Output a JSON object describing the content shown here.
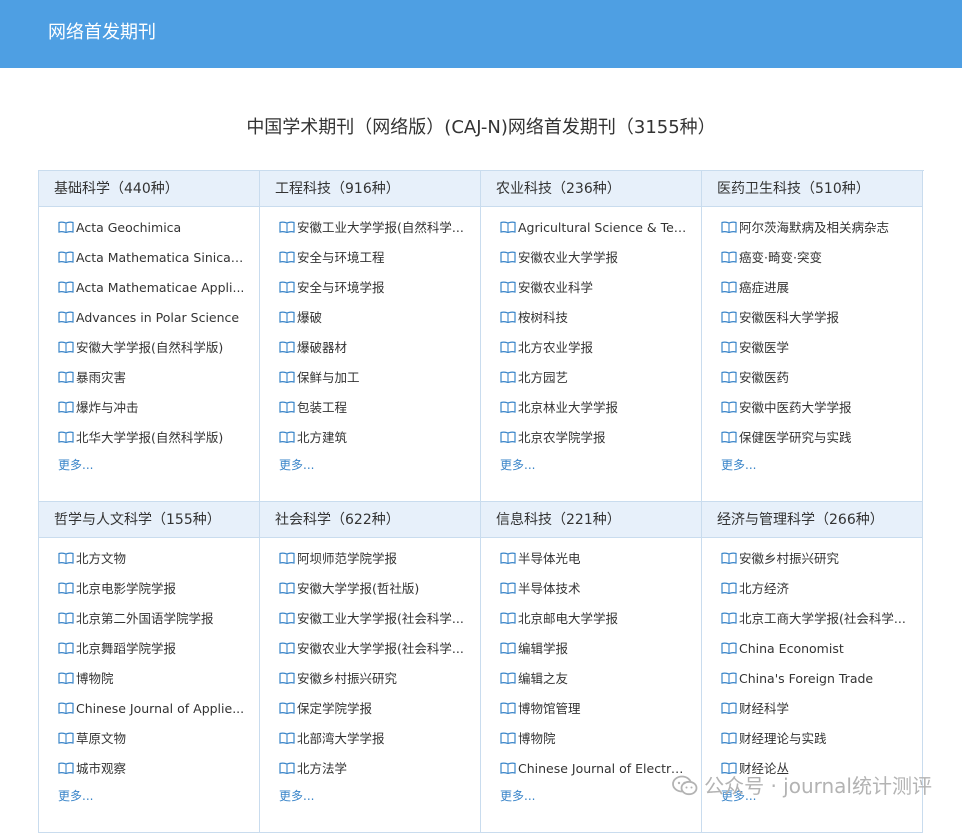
{
  "header": {
    "title": "网络首发期刊"
  },
  "page_title": "中国学术期刊（网络版）(CAJ-N)网络首发期刊（3155种）",
  "colors": {
    "header_bg": "#4e9fe3",
    "panel_header_bg": "#e7f0fa",
    "border": "#c9dcee",
    "link": "#3a85c9"
  },
  "item_icon": "book-icon",
  "panels": [
    {
      "title": "基础科学（440种）",
      "items": [
        "Acta Geochimica",
        "Acta Mathematica Sinica,...",
        "Acta Mathematicae Appli...",
        "Advances in Polar Science",
        "安徽大学学报(自然科学版)",
        "暴雨灾害",
        "爆炸与冲击",
        "北华大学学报(自然科学版)"
      ],
      "more": "更多..."
    },
    {
      "title": "工程科技（916种）",
      "items": [
        "安徽工业大学学报(自然科学...",
        "安全与环境工程",
        "安全与环境学报",
        "爆破",
        "爆破器材",
        "保鲜与加工",
        "包装工程",
        "北方建筑"
      ],
      "more": "更多..."
    },
    {
      "title": "农业科技（236种）",
      "items": [
        "Agricultural Science & Tec...",
        "安徽农业大学学报",
        "安徽农业科学",
        "桉树科技",
        "北方农业学报",
        "北方园艺",
        "北京林业大学学报",
        "北京农学院学报"
      ],
      "more": "更多..."
    },
    {
      "title": "医药卫生科技（510种）",
      "items": [
        "阿尔茨海默病及相关病杂志",
        "癌变·畸变·突变",
        "癌症进展",
        "安徽医科大学学报",
        "安徽医学",
        "安徽医药",
        "安徽中医药大学学报",
        "保健医学研究与实践"
      ],
      "more": "更多..."
    },
    {
      "title": "哲学与人文科学（155种）",
      "items": [
        "北方文物",
        "北京电影学院学报",
        "北京第二外国语学院学报",
        "北京舞蹈学院学报",
        "博物院",
        "Chinese Journal of Applie...",
        "草原文物",
        "城市观察"
      ],
      "more": "更多..."
    },
    {
      "title": "社会科学（622种）",
      "items": [
        "阿坝师范学院学报",
        "安徽大学学报(哲社版)",
        "安徽工业大学学报(社会科学...",
        "安徽农业大学学报(社会科学...",
        "安徽乡村振兴研究",
        "保定学院学报",
        "北部湾大学学报",
        "北方法学"
      ],
      "more": "更多..."
    },
    {
      "title": "信息科技（221种）",
      "items": [
        "半导体光电",
        "半导体技术",
        "北京邮电大学学报",
        "编辑学报",
        "编辑之友",
        "博物馆管理",
        "博物院",
        "Chinese Journal of Electro..."
      ],
      "more": "更多..."
    },
    {
      "title": "经济与管理科学（266种）",
      "items": [
        "安徽乡村振兴研究",
        "北方经济",
        "北京工商大学学报(社会科学...",
        "China Economist",
        "China's Foreign Trade",
        "财经科学",
        "财经理论与实践",
        "财经论丛"
      ],
      "more": "更多..."
    }
  ],
  "watermark": "公众号 · journal统计测评"
}
